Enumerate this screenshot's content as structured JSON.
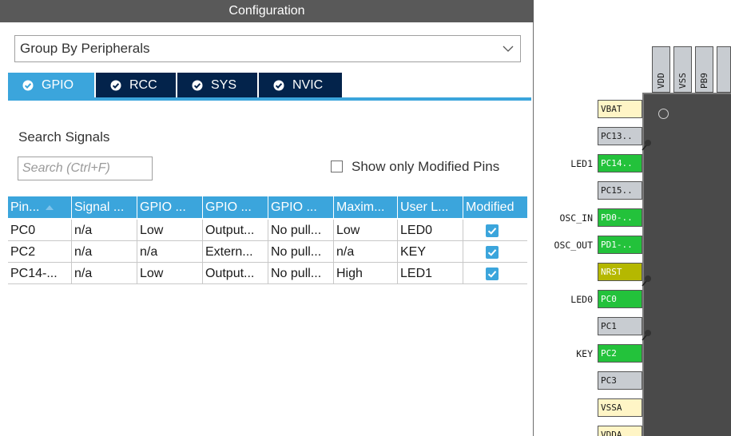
{
  "config": {
    "title": "Configuration",
    "group_by": "Group By Peripherals",
    "tabs": [
      {
        "label": "GPIO",
        "active": true
      },
      {
        "label": "RCC",
        "active": false
      },
      {
        "label": "SYS",
        "active": false
      },
      {
        "label": "NVIC",
        "active": false
      }
    ],
    "search_label": "Search Signals",
    "search_placeholder": "Search (Ctrl+F)",
    "show_modified_label": "Show only Modified Pins",
    "show_modified_checked": false,
    "table": {
      "headers": [
        "Pin...",
        "Signal ...",
        "GPIO ...",
        "GPIO ...",
        "GPIO ...",
        "Maxim...",
        "User L...",
        "Modified"
      ],
      "rows": [
        {
          "pin": "PC0",
          "signal": "n/a",
          "gpio_output_level": "Low",
          "gpio_mode": "Output...",
          "gpio_pull": "No pull...",
          "max_speed": "Low",
          "user_label": "LED0",
          "modified": true
        },
        {
          "pin": "PC2",
          "signal": "n/a",
          "gpio_output_level": "n/a",
          "gpio_mode": "Extern...",
          "gpio_pull": "No pull...",
          "max_speed": "n/a",
          "user_label": "KEY",
          "modified": true
        },
        {
          "pin": "PC14-...",
          "signal": "n/a",
          "gpio_output_level": "Low",
          "gpio_mode": "Output...",
          "gpio_pull": "No pull...",
          "max_speed": "High",
          "user_label": "LED1",
          "modified": true
        }
      ]
    }
  },
  "chip": {
    "top_pins": [
      "VDD",
      "VSS",
      "PB9"
    ],
    "left_pins": [
      {
        "name": "VBAT",
        "color": "yellow",
        "label": ""
      },
      {
        "name": "PC13..",
        "color": "gray",
        "label": ""
      },
      {
        "name": "PC14..",
        "color": "green",
        "label": "LED1",
        "pinned": true
      },
      {
        "name": "PC15..",
        "color": "gray",
        "label": ""
      },
      {
        "name": "PD0-..",
        "color": "green",
        "label": "OSC_IN"
      },
      {
        "name": "PD1-..",
        "color": "green",
        "label": "OSC_OUT"
      },
      {
        "name": "NRST",
        "color": "olive",
        "label": ""
      },
      {
        "name": "PC0",
        "color": "green",
        "label": "LED0",
        "pinned": true
      },
      {
        "name": "PC1",
        "color": "gray",
        "label": ""
      },
      {
        "name": "PC2",
        "color": "green",
        "label": "KEY",
        "pinned": true
      },
      {
        "name": "PC3",
        "color": "gray",
        "label": ""
      },
      {
        "name": "VSSA",
        "color": "yellow",
        "label": ""
      },
      {
        "name": "VDDA",
        "color": "yellow",
        "label": ""
      }
    ]
  },
  "colors": {
    "accent": "#3ba5dc",
    "tab_dark": "#03234b",
    "pin_green": "#23c23b",
    "pin_gray": "#c8ccd1",
    "pin_yellow": "#fff5c6",
    "pin_olive": "#b5b800"
  }
}
